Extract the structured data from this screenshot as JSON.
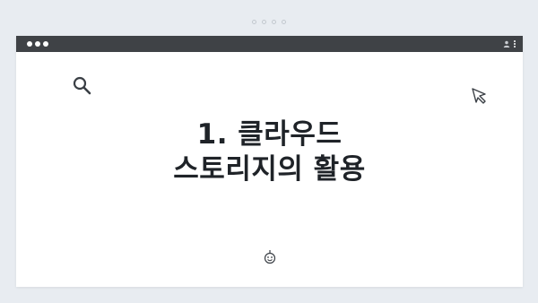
{
  "pagination": {
    "dots": 4
  },
  "window": {
    "titlebar_color": "#3f4246",
    "icons": [
      "user-icon",
      "kebab-menu-icon"
    ]
  },
  "content": {
    "title_line1": "1. 클라우드",
    "title_line2": "스토리지의 활용",
    "icons": [
      "search-icon",
      "cursor-icon",
      "smile-icon"
    ]
  }
}
